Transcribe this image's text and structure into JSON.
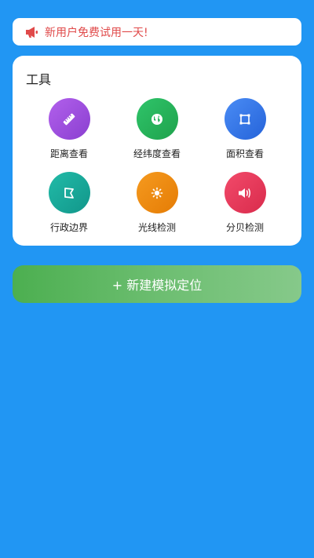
{
  "notice": {
    "text": "新用户免费试用一天!",
    "icon": "megaphone-icon",
    "color": "#e04a4a"
  },
  "tools": {
    "title": "工具",
    "items": [
      {
        "label": "距离查看",
        "icon": "ruler-icon",
        "color": "#9c4fdc"
      },
      {
        "label": "经纬度查看",
        "icon": "globe-icon",
        "color": "#25b25a"
      },
      {
        "label": "面积查看",
        "icon": "area-icon",
        "color": "#3478e8"
      },
      {
        "label": "行政边界",
        "icon": "boundary-icon",
        "color": "#16a89a"
      },
      {
        "label": "光线检测",
        "icon": "sun-icon",
        "color": "#ee8a0e"
      },
      {
        "label": "分贝检测",
        "icon": "volume-icon",
        "color": "#e73657"
      }
    ]
  },
  "action": {
    "label": "+ 新建模拟定位"
  }
}
